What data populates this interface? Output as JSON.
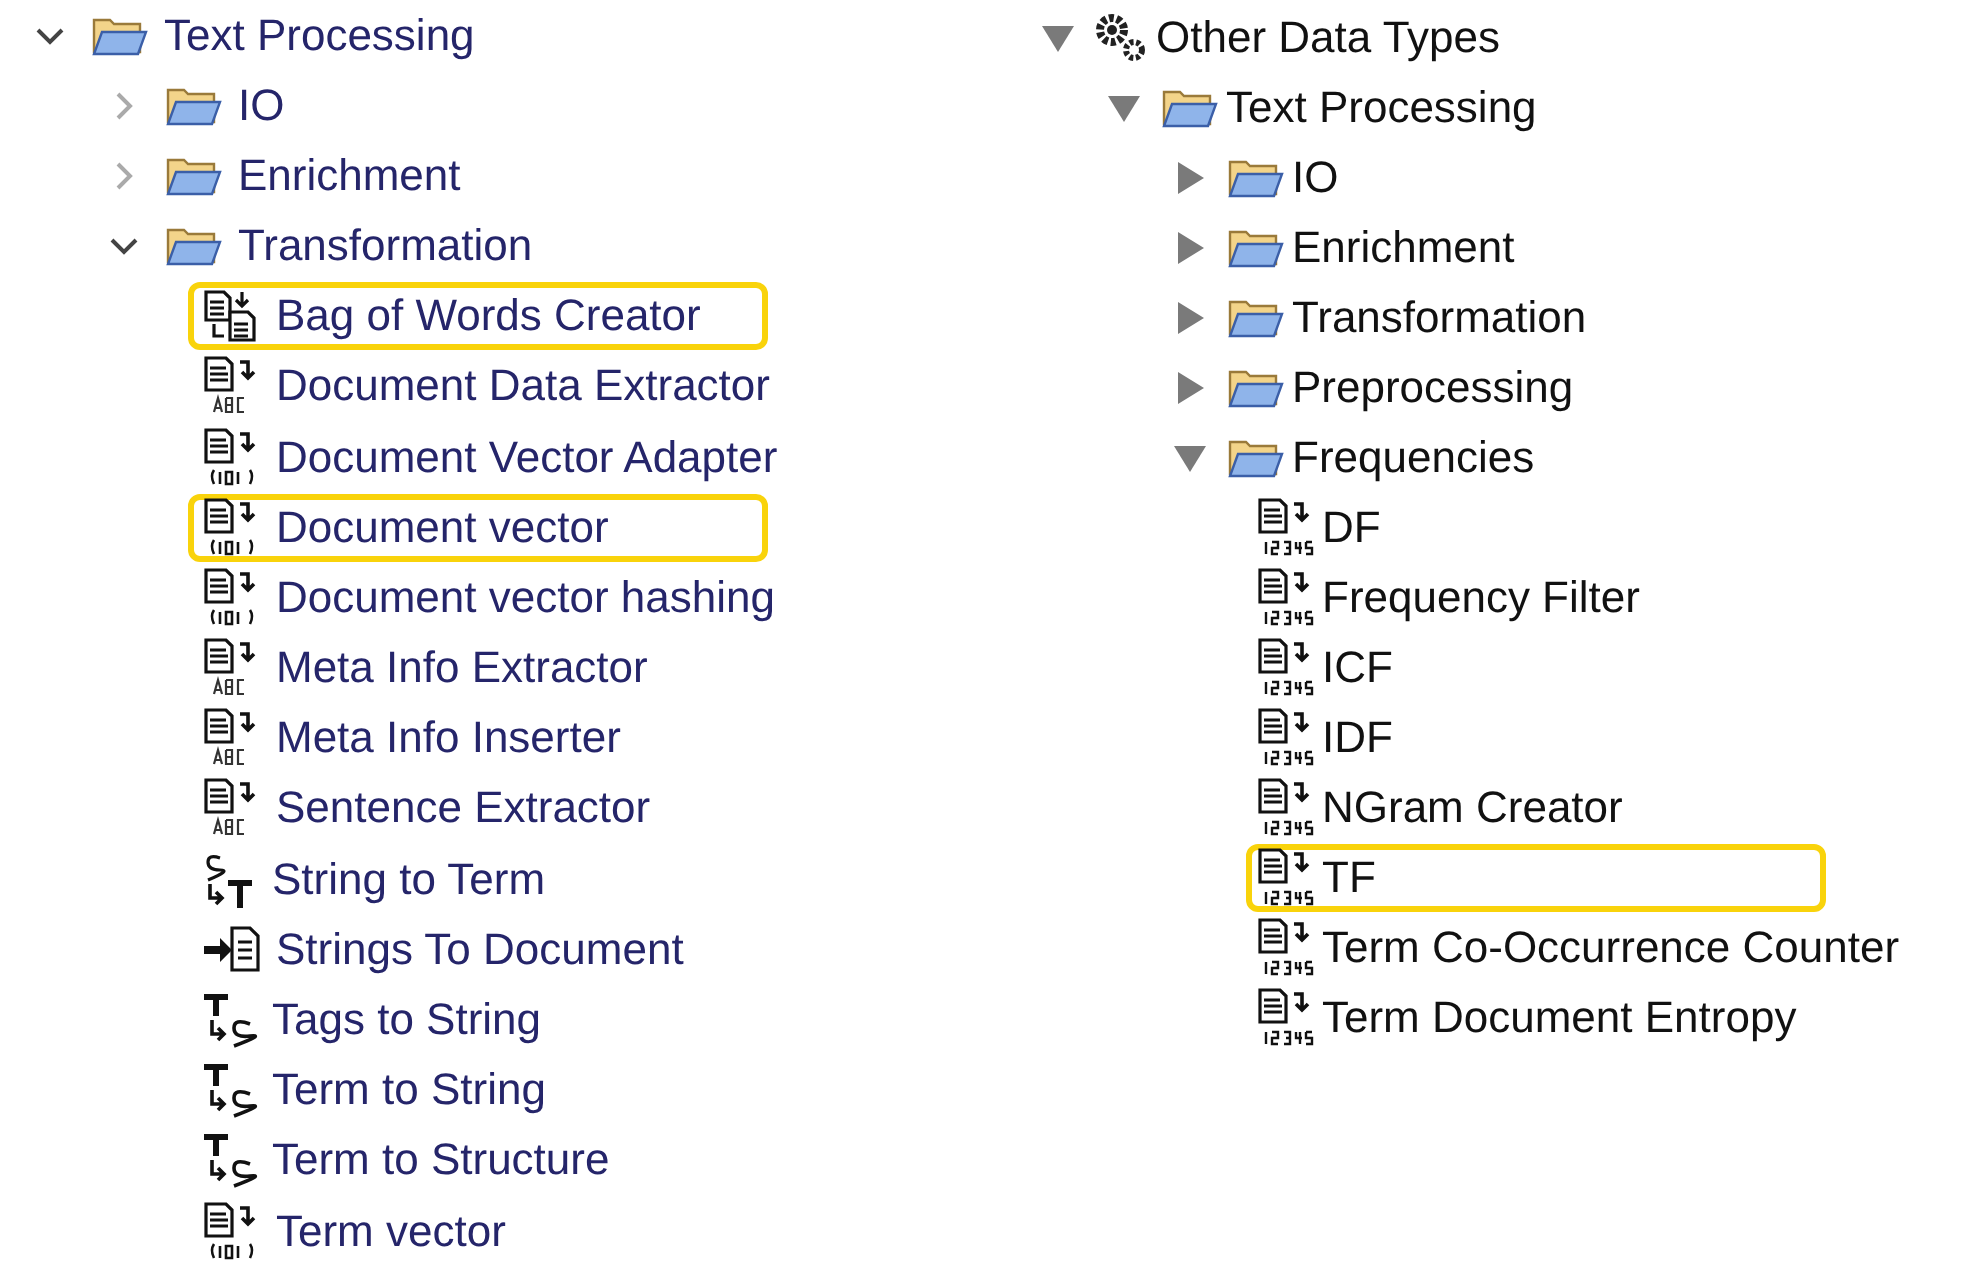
{
  "trees": [
    {
      "kind": "chevron",
      "items": [
        {
          "label": "Text Processing",
          "kind": "folder",
          "expanded": true,
          "highlighted": false,
          "children": [
            {
              "label": "IO",
              "kind": "folder",
              "expanded": false,
              "highlighted": false
            },
            {
              "label": "Enrichment",
              "kind": "folder",
              "expanded": false,
              "highlighted": false
            },
            {
              "label": "Transformation",
              "kind": "folder",
              "expanded": true,
              "highlighted": false,
              "children": [
                {
                  "label": "Bag of Words Creator",
                  "kind": "bag",
                  "highlighted": true
                },
                {
                  "label": "Document Data Extractor",
                  "kind": "doc-abc",
                  "highlighted": false
                },
                {
                  "label": "Document Vector Adapter",
                  "kind": "doc-binary",
                  "highlighted": false
                },
                {
                  "label": "Document vector",
                  "kind": "doc-binary",
                  "highlighted": true
                },
                {
                  "label": "Document vector hashing",
                  "kind": "doc-binary",
                  "highlighted": false
                },
                {
                  "label": "Meta Info Extractor",
                  "kind": "doc-abc",
                  "highlighted": false
                },
                {
                  "label": "Meta Info Inserter",
                  "kind": "doc-abc",
                  "highlighted": false
                },
                {
                  "label": "Sentence Extractor",
                  "kind": "doc-abc",
                  "highlighted": false
                },
                {
                  "label": "String to Term",
                  "kind": "string-term",
                  "highlighted": false
                },
                {
                  "label": "Strings To Document",
                  "kind": "strings-doc",
                  "highlighted": false
                },
                {
                  "label": "Tags to String",
                  "kind": "term-string",
                  "highlighted": false
                },
                {
                  "label": "Term to String",
                  "kind": "term-string",
                  "highlighted": false
                },
                {
                  "label": "Term to Structure",
                  "kind": "term-string",
                  "highlighted": false
                },
                {
                  "label": "Term vector",
                  "kind": "doc-binary",
                  "highlighted": false
                }
              ]
            }
          ]
        }
      ]
    },
    {
      "kind": "triangle",
      "items": [
        {
          "label": "Other Data Types",
          "kind": "gears",
          "expanded": true,
          "highlighted": false,
          "children": [
            {
              "label": "Text Processing",
              "kind": "folder",
              "expanded": true,
              "highlighted": false,
              "children": [
                {
                  "label": "IO",
                  "kind": "folder",
                  "expanded": false,
                  "highlighted": false
                },
                {
                  "label": "Enrichment",
                  "kind": "folder",
                  "expanded": false,
                  "highlighted": false
                },
                {
                  "label": "Transformation",
                  "kind": "folder",
                  "expanded": false,
                  "highlighted": false
                },
                {
                  "label": "Preprocessing",
                  "kind": "folder",
                  "expanded": false,
                  "highlighted": false
                },
                {
                  "label": "Frequencies",
                  "kind": "folder",
                  "expanded": true,
                  "highlighted": false,
                  "children": [
                    {
                      "label": "DF",
                      "kind": "doc-numbers",
                      "highlighted": false
                    },
                    {
                      "label": "Frequency Filter",
                      "kind": "doc-numbers",
                      "highlighted": false
                    },
                    {
                      "label": "ICF",
                      "kind": "doc-numbers",
                      "highlighted": false
                    },
                    {
                      "label": "IDF",
                      "kind": "doc-numbers",
                      "highlighted": false
                    },
                    {
                      "label": "NGram Creator",
                      "kind": "doc-numbers",
                      "highlighted": false
                    },
                    {
                      "label": "TF",
                      "kind": "doc-numbers",
                      "highlighted": true
                    },
                    {
                      "label": "Term Co-Occurrence Counter",
                      "kind": "doc-numbers",
                      "highlighted": false
                    },
                    {
                      "label": "Term Document Entropy",
                      "kind": "doc-numbers",
                      "highlighted": false
                    }
                  ]
                }
              ]
            }
          ]
        }
      ]
    }
  ]
}
